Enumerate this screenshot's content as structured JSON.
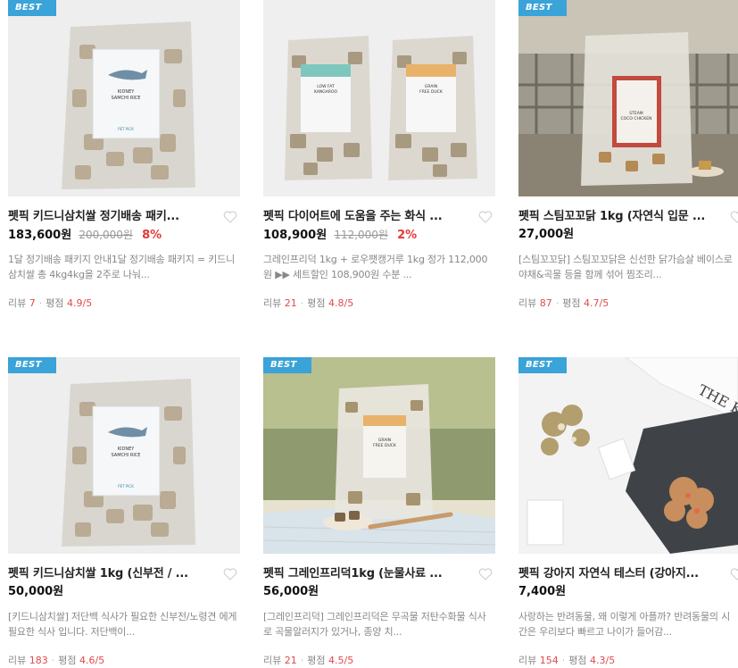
{
  "badge": "BEST",
  "products": [
    {
      "title": "펫픽 키드니삼치쌀 정기배송 패키...",
      "price": "183,600원",
      "original_price": "200,000원",
      "discount": "8%",
      "description": "1달 정기배송 패키지 안내1달 정기배송 패키지 = 키드니삼치쌀 총 4kg4kg을 2주로 나눠...",
      "review_label": "리뷰",
      "review_count": "7",
      "rating_label": "평점",
      "rating": "4.9/5",
      "package_text": [
        "KIDNEY",
        "SAMCHI RICE",
        "PET PICK"
      ],
      "has_badge": true
    },
    {
      "title": "펫픽 다이어트에 도움을 주는 화식 ...",
      "price": "108,900원",
      "original_price": "112,000원",
      "discount": "2%",
      "description": "그레인프리덕 1kg + 로우팻캥거루 1kg 정가 112,000원 ▶▶ 세트할인 108,900원 수분 ...",
      "review_label": "리뷰",
      "review_count": "21",
      "rating_label": "평점",
      "rating": "4.8/5",
      "package_text": [
        "LOW FAT",
        "KANGAROO",
        "GRAIN",
        "FREE DUCK"
      ],
      "has_badge": false
    },
    {
      "title": "펫픽 스팀꼬꼬닭 1kg (자연식 입문 ...",
      "price": "27,000원",
      "original_price": "",
      "discount": "",
      "description": "[스팀꼬꼬닭] 스팀꼬꼬닭은 신선한 닭가슴살 베이스로 야채&곡물 등을 함께 섞어 찜조리...",
      "review_label": "리뷰",
      "review_count": "87",
      "rating_label": "평점",
      "rating": "4.7/5",
      "package_text": [
        "STEAM",
        "COCO CHICKEN"
      ],
      "has_badge": true
    },
    {
      "title": "펫픽 키드니삼치쌀 1kg (신부전 / ...",
      "price": "50,000원",
      "original_price": "",
      "discount": "",
      "description": "[키드니삼치쌀] 저단백 식사가 필요한 신부전/노령견 에게 필요한 식사 입니다. 저단백이...",
      "review_label": "리뷰",
      "review_count": "183",
      "rating_label": "평점",
      "rating": "4.6/5",
      "package_text": [
        "KIDNEY",
        "SAMCHI RICE",
        "PET PICK"
      ],
      "has_badge": true
    },
    {
      "title": "펫픽 그레인프리덕1kg (눈물사료 ...",
      "price": "56,000원",
      "original_price": "",
      "discount": "",
      "description": "[그레인프리덕] 그레인프리덕은 무곡물 저탄수화물 식사로 곡물알러지가 있거나, 종양 치...",
      "review_label": "리뷰",
      "review_count": "21",
      "rating_label": "평점",
      "rating": "4.5/5",
      "package_text": [
        "GRAIN",
        "FREE DUCK"
      ],
      "has_badge": true
    },
    {
      "title": "펫픽 강아지 자연식 테스터 (강아지...",
      "price": "7,400원",
      "original_price": "",
      "discount": "",
      "description": "사랑하는 반려동물, 왜 이렇게 아플까? 반려동물의 시간은 우리보다 빠르고 나이가 들어감...",
      "review_label": "리뷰",
      "review_count": "154",
      "rating_label": "평점",
      "rating": "4.3/5",
      "package_text": [
        "THE KIN"
      ],
      "has_badge": true
    }
  ],
  "colors": {
    "badge": "#3aa3d8",
    "discount": "#e53838",
    "highlight": "#e04a4a",
    "muted": "#888888"
  }
}
